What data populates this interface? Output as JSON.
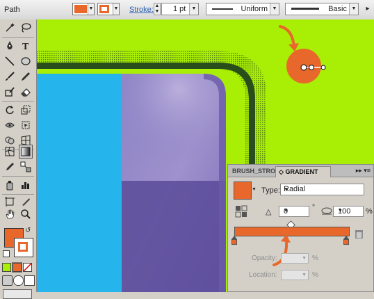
{
  "control_bar": {
    "path_label": "Path",
    "fill_color": "#e8682b",
    "stroke_color": "#e8682b",
    "stroke_label": "Stroke:",
    "stroke_weight": "1 pt",
    "variable_width_profile": "Uniform",
    "brush_definition": "Basic"
  },
  "gradient_panel": {
    "tabs": [
      "BRUSH_STROK",
      "GRADIENT"
    ],
    "active_tab_prefix": "◇",
    "type_label": "Type:",
    "type_value": "Radial",
    "angle_value": "0",
    "degree_symbol": "°",
    "aspect_ratio_value": "100",
    "percent": "%",
    "opacity_label": "Opacity:",
    "location_label": "Location:",
    "stop_color": "#e8682b"
  },
  "colors": {
    "canvas_green": "#a9ee05",
    "accent_orange": "#e8682b",
    "blue_panel": "#25b5ec",
    "purple_shape": "#6a5aa8"
  }
}
